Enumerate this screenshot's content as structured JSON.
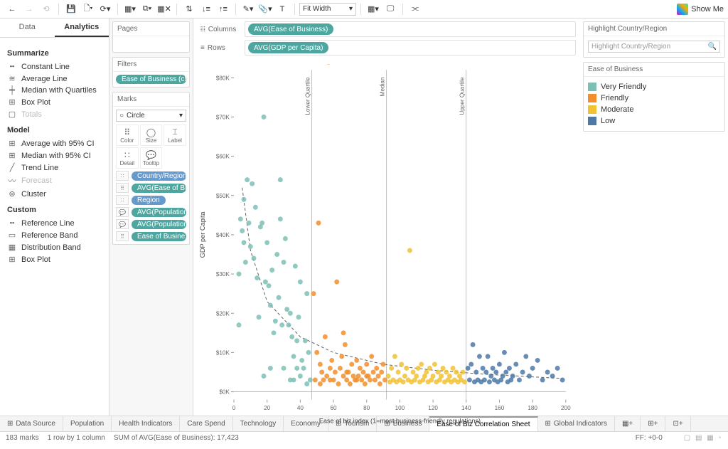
{
  "toolbar": {
    "fit_label": "Fit Width",
    "show_me_label": "Show Me"
  },
  "left": {
    "data_tab": "Data",
    "analytics_tab": "Analytics",
    "sections": [
      {
        "title": "Summarize",
        "items": [
          {
            "label": "Constant Line"
          },
          {
            "label": "Average Line"
          },
          {
            "label": "Median with Quartiles"
          },
          {
            "label": "Box Plot"
          },
          {
            "label": "Totals",
            "disabled": true
          }
        ]
      },
      {
        "title": "Model",
        "items": [
          {
            "label": "Average with 95% CI"
          },
          {
            "label": "Median with 95% CI"
          },
          {
            "label": "Trend Line"
          },
          {
            "label": "Forecast",
            "disabled": true
          },
          {
            "label": "Cluster"
          }
        ]
      },
      {
        "title": "Custom",
        "items": [
          {
            "label": "Reference Line"
          },
          {
            "label": "Reference Band"
          },
          {
            "label": "Distribution Band"
          },
          {
            "label": "Box Plot"
          }
        ]
      }
    ]
  },
  "cards": {
    "pages_title": "Pages",
    "filters_title": "Filters",
    "filters_pill": "Ease of Business (cl..",
    "marks_title": "Marks",
    "marks_type": "Circle",
    "mark_cells": [
      "Color",
      "Size",
      "Label",
      "Detail",
      "Tooltip"
    ],
    "mark_pills": [
      {
        "label": "Country/Region",
        "slot": "Det",
        "cls": "blue"
      },
      {
        "label": "AVG(Ease of Busi..",
        "slot": "Col",
        "cls": "teal"
      },
      {
        "label": "Region",
        "slot": "Det",
        "cls": "blue"
      },
      {
        "label": "AVG(Population ..",
        "slot": "TT",
        "cls": "teal"
      },
      {
        "label": "AVG(Population ..",
        "slot": "TT",
        "cls": "teal"
      },
      {
        "label": "Ease of Busine..",
        "slot": "Col",
        "cls": "teal",
        "lead": "⠿"
      }
    ]
  },
  "shelves": {
    "columns_label": "Columns",
    "columns_pill": "AVG(Ease of Business)",
    "rows_label": "Rows",
    "rows_pill": "AVG(GDP per Capita)"
  },
  "chart_meta": {
    "y_axis_title": "GDP per Capita",
    "x_axis_title": "Ease of biz index (1=most business-friendly regulations)",
    "ref_labels": [
      "Lower Quartile",
      "Median",
      "Upper Quartile"
    ]
  },
  "right": {
    "highlight_title": "Highlight Country/Region",
    "highlight_placeholder": "Highlight Country/Region",
    "legend_title": "Ease of Business",
    "legend": [
      {
        "label": "Very Friendly",
        "color": "#7bbfb5"
      },
      {
        "label": "Friendly",
        "color": "#f28e2b"
      },
      {
        "label": "Moderate",
        "color": "#f1c232"
      },
      {
        "label": "Low",
        "color": "#4e79a7"
      }
    ]
  },
  "tabs": [
    {
      "label": "Data Source",
      "icon": "⊞"
    },
    {
      "label": "Population"
    },
    {
      "label": "Health Indicators"
    },
    {
      "label": "Care Spend"
    },
    {
      "label": "Technology"
    },
    {
      "label": "Economy"
    },
    {
      "label": "Tourism",
      "icon": "⊞"
    },
    {
      "label": "Business",
      "icon": "⊞"
    },
    {
      "label": "Ease of Biz Correlation Sheet",
      "active": true
    },
    {
      "label": "Global Indicators",
      "icon": "⊞"
    }
  ],
  "status": {
    "marks": "183 marks",
    "rc": "1 row by 1 column",
    "sum": "SUM of AVG(Ease of Business): 17,423",
    "ff": "FF: +0-0"
  },
  "chart_data": {
    "type": "scatter",
    "xlabel": "Ease of biz index (1=most business-friendly regulations)",
    "ylabel": "GDP per Capita",
    "xlim": [
      0,
      200
    ],
    "ylim": [
      -2000,
      82000
    ],
    "x_ticks": [
      0,
      20,
      40,
      60,
      80,
      100,
      120,
      140,
      160,
      180,
      200
    ],
    "y_ticks": [
      0,
      10000,
      20000,
      30000,
      40000,
      50000,
      60000,
      70000,
      80000
    ],
    "y_tick_labels": [
      "$0K",
      "$10K",
      "$20K",
      "$30K",
      "$40K",
      "$50K",
      "$60K",
      "$70K",
      "$80K"
    ],
    "reference_lines_x": [
      47,
      92,
      140
    ],
    "trend": {
      "type": "power",
      "points": [
        [
          5,
          52000
        ],
        [
          10,
          36000
        ],
        [
          20,
          23000
        ],
        [
          40,
          14000
        ],
        [
          60,
          10000
        ],
        [
          90,
          7000
        ],
        [
          120,
          5500
        ],
        [
          150,
          4500
        ],
        [
          180,
          3800
        ],
        [
          198,
          3400
        ]
      ]
    },
    "series": [
      {
        "name": "Very Friendly",
        "color": "#7bbfb5",
        "points": [
          [
            3,
            30000
          ],
          [
            3,
            17000
          ],
          [
            4,
            44000
          ],
          [
            5,
            41000
          ],
          [
            6,
            49000
          ],
          [
            6,
            38000
          ],
          [
            7,
            33000
          ],
          [
            8,
            54000
          ],
          [
            9,
            43000
          ],
          [
            10,
            37000
          ],
          [
            11,
            53000
          ],
          [
            12,
            34000
          ],
          [
            13,
            47000
          ],
          [
            14,
            29000
          ],
          [
            15,
            19000
          ],
          [
            16,
            42000
          ],
          [
            17,
            43000
          ],
          [
            18,
            70000
          ],
          [
            19,
            28000
          ],
          [
            20,
            38000
          ],
          [
            21,
            27000
          ],
          [
            22,
            22000
          ],
          [
            23,
            31000
          ],
          [
            24,
            15000
          ],
          [
            25,
            18000
          ],
          [
            26,
            35000
          ],
          [
            27,
            24000
          ],
          [
            28,
            44000
          ],
          [
            29,
            17000
          ],
          [
            30,
            33000
          ],
          [
            31,
            39000
          ],
          [
            32,
            21000
          ],
          [
            33,
            17000
          ],
          [
            34,
            20000
          ],
          [
            35,
            14000
          ],
          [
            36,
            9000
          ],
          [
            37,
            32000
          ],
          [
            38,
            13000
          ],
          [
            39,
            19000
          ],
          [
            40,
            28000
          ],
          [
            41,
            8000
          ],
          [
            42,
            6000
          ],
          [
            43,
            13000
          ],
          [
            44,
            25000
          ],
          [
            45,
            10000
          ],
          [
            46,
            3000
          ],
          [
            18,
            4000
          ],
          [
            22,
            6000
          ],
          [
            30,
            6000
          ],
          [
            34,
            3000
          ],
          [
            40,
            4000
          ],
          [
            28,
            54000
          ],
          [
            36,
            3000
          ],
          [
            44,
            2000
          ],
          [
            38,
            6000
          ]
        ]
      },
      {
        "name": "Friendly",
        "color": "#f28e2b",
        "points": [
          [
            48,
            25000
          ],
          [
            49,
            3000
          ],
          [
            50,
            10000
          ],
          [
            51,
            43000
          ],
          [
            52,
            7000
          ],
          [
            53,
            5000
          ],
          [
            54,
            3000
          ],
          [
            55,
            14000
          ],
          [
            56,
            4000
          ],
          [
            57,
            84000
          ],
          [
            58,
            6000
          ],
          [
            59,
            8000
          ],
          [
            60,
            3000
          ],
          [
            61,
            5000
          ],
          [
            62,
            28000
          ],
          [
            63,
            2000
          ],
          [
            64,
            6000
          ],
          [
            65,
            9000
          ],
          [
            66,
            4000
          ],
          [
            67,
            12000
          ],
          [
            68,
            3000
          ],
          [
            69,
            5000
          ],
          [
            70,
            2000
          ],
          [
            71,
            7000
          ],
          [
            72,
            4000
          ],
          [
            73,
            3000
          ],
          [
            74,
            8000
          ],
          [
            75,
            4000
          ],
          [
            76,
            6000
          ],
          [
            77,
            3000
          ],
          [
            78,
            5000
          ],
          [
            79,
            2000
          ],
          [
            80,
            7000
          ],
          [
            81,
            4000
          ],
          [
            82,
            3000
          ],
          [
            83,
            9000
          ],
          [
            84,
            5000
          ],
          [
            85,
            3000
          ],
          [
            86,
            6000
          ],
          [
            87,
            4000
          ],
          [
            88,
            2000
          ],
          [
            89,
            5000
          ],
          [
            90,
            7000
          ],
          [
            91,
            3000
          ],
          [
            52,
            2000
          ],
          [
            58,
            3000
          ],
          [
            68,
            5000
          ],
          [
            74,
            3000
          ],
          [
            80,
            4000
          ],
          [
            66,
            15000
          ]
        ]
      },
      {
        "name": "Moderate",
        "color": "#f1c232",
        "points": [
          [
            93,
            4000
          ],
          [
            94,
            2500
          ],
          [
            95,
            6000
          ],
          [
            96,
            3000
          ],
          [
            97,
            9000
          ],
          [
            98,
            2500
          ],
          [
            99,
            5000
          ],
          [
            100,
            3000
          ],
          [
            101,
            7000
          ],
          [
            102,
            2500
          ],
          [
            103,
            4000
          ],
          [
            104,
            6000
          ],
          [
            105,
            3000
          ],
          [
            106,
            36000
          ],
          [
            107,
            2500
          ],
          [
            108,
            5000
          ],
          [
            109,
            3000
          ],
          [
            110,
            4000
          ],
          [
            111,
            6000
          ],
          [
            112,
            2500
          ],
          [
            113,
            7000
          ],
          [
            114,
            3000
          ],
          [
            115,
            4000
          ],
          [
            116,
            5000
          ],
          [
            117,
            2500
          ],
          [
            118,
            6000
          ],
          [
            119,
            3000
          ],
          [
            120,
            4000
          ],
          [
            121,
            7000
          ],
          [
            122,
            2500
          ],
          [
            123,
            5000
          ],
          [
            124,
            3000
          ],
          [
            125,
            4000
          ],
          [
            126,
            6000
          ],
          [
            127,
            2500
          ],
          [
            128,
            5000
          ],
          [
            129,
            3000
          ],
          [
            130,
            4000
          ],
          [
            131,
            2500
          ],
          [
            132,
            6000
          ],
          [
            133,
            3000
          ],
          [
            134,
            5000
          ],
          [
            135,
            2500
          ],
          [
            136,
            4000
          ],
          [
            137,
            3000
          ],
          [
            138,
            5000
          ],
          [
            139,
            2500
          ]
        ]
      },
      {
        "name": "Low",
        "color": "#4e79a7",
        "points": [
          [
            141,
            6000
          ],
          [
            142,
            3000
          ],
          [
            143,
            7000
          ],
          [
            144,
            12000
          ],
          [
            145,
            2500
          ],
          [
            146,
            5000
          ],
          [
            147,
            3000
          ],
          [
            148,
            9000
          ],
          [
            149,
            2500
          ],
          [
            150,
            6000
          ],
          [
            151,
            3000
          ],
          [
            152,
            5000
          ],
          [
            153,
            9000
          ],
          [
            154,
            2500
          ],
          [
            155,
            4000
          ],
          [
            156,
            6000
          ],
          [
            157,
            3000
          ],
          [
            158,
            5000
          ],
          [
            159,
            2500
          ],
          [
            160,
            7000
          ],
          [
            161,
            3000
          ],
          [
            162,
            4000
          ],
          [
            163,
            10000
          ],
          [
            164,
            5000
          ],
          [
            165,
            2500
          ],
          [
            166,
            6000
          ],
          [
            167,
            3000
          ],
          [
            168,
            4000
          ],
          [
            170,
            7000
          ],
          [
            172,
            3000
          ],
          [
            174,
            5000
          ],
          [
            176,
            9000
          ],
          [
            178,
            4000
          ],
          [
            180,
            6000
          ],
          [
            183,
            8000
          ],
          [
            186,
            3000
          ],
          [
            189,
            5000
          ],
          [
            192,
            4000
          ],
          [
            195,
            6000
          ],
          [
            198,
            3000
          ]
        ]
      }
    ]
  }
}
